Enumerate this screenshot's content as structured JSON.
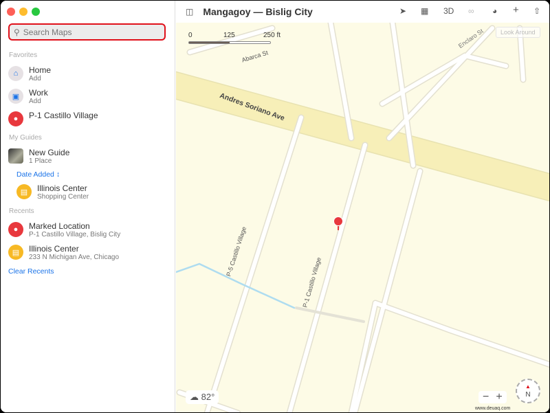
{
  "window": {
    "title": "Mangagoy — Bislig City"
  },
  "search": {
    "placeholder": "Search Maps"
  },
  "sidebar": {
    "favorites_label": "Favorites",
    "favorites": [
      {
        "title": "Home",
        "subtitle": "Add",
        "icon": "home-icon"
      },
      {
        "title": "Work",
        "subtitle": "Add",
        "icon": "briefcase-icon"
      },
      {
        "title": "P-1 Castillo Village",
        "icon": "pin-icon"
      }
    ],
    "guides_label": "My Guides",
    "guide": {
      "title": "New Guide",
      "subtitle": "1 Place"
    },
    "sort_label": "Date Added",
    "guide_item": {
      "title": "Illinois Center",
      "subtitle": "Shopping Center"
    },
    "recents_label": "Recents",
    "recents": [
      {
        "title": "Marked Location",
        "subtitle": "P-1 Castillo Village, Bislig City"
      },
      {
        "title": "Illinois Center",
        "subtitle": "233 N Michigan Ave, Chicago"
      }
    ],
    "clear_label": "Clear Recents"
  },
  "toolbar": {
    "threed": "3D"
  },
  "map": {
    "scale": [
      "0",
      "125",
      "250 ft"
    ],
    "look_around": "Look Around",
    "streets": {
      "main": "Andres Soriano Ave",
      "p5": "P-5 Castillo Village",
      "p1": "P-1 Castillo Village",
      "abarca": "Abarca St",
      "enclaro": "Enclaro St"
    },
    "weather": "82°",
    "zoom_out": "−",
    "zoom_in": "+",
    "compass": "N",
    "watermark": "www.deuaq.com"
  },
  "colors": {
    "accent": "#1a73e8",
    "pin": "#e8383d",
    "shop": "#f7b924",
    "road": "#f7efb8"
  }
}
